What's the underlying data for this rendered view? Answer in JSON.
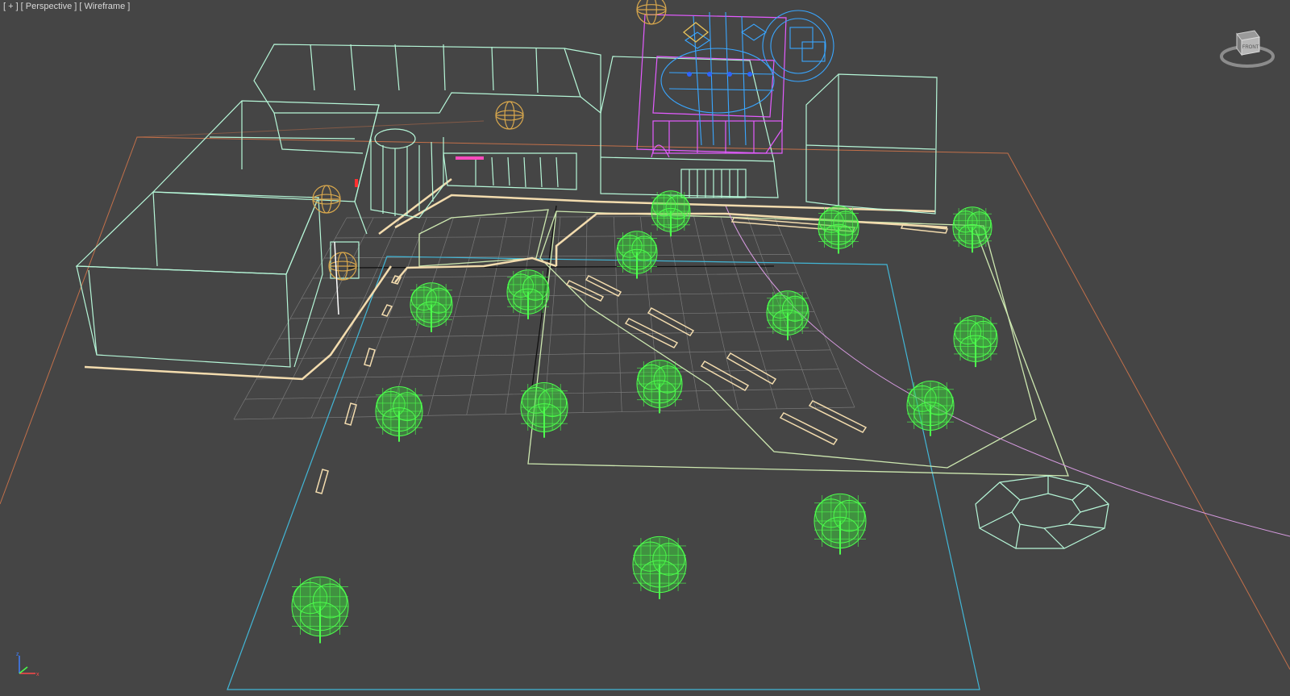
{
  "viewport": {
    "labels": {
      "plus": "[ + ]",
      "view": "[ Perspective ]",
      "shading": "[ Wireframe ]"
    },
    "viewcube": {
      "face_label": "FRONT",
      "icon": "viewcube-icon"
    },
    "axis_tripod": {
      "icon": "axis-tripod-icon",
      "axes": [
        "x",
        "y",
        "z"
      ]
    }
  },
  "colors": {
    "background": "#454545",
    "building_wire": "#b6f7d8",
    "road_markings": "#f3dcae",
    "trees": "#4dff4d",
    "grid": "#8a8a8a",
    "selection_magenta": "#e35cff",
    "selection_blue": "#39a6ff",
    "ground_plane": "#c2704a",
    "cyan_outline": "#42b6d6",
    "light_yellow": "#d9a84d",
    "pink_path": "#d79be0"
  }
}
